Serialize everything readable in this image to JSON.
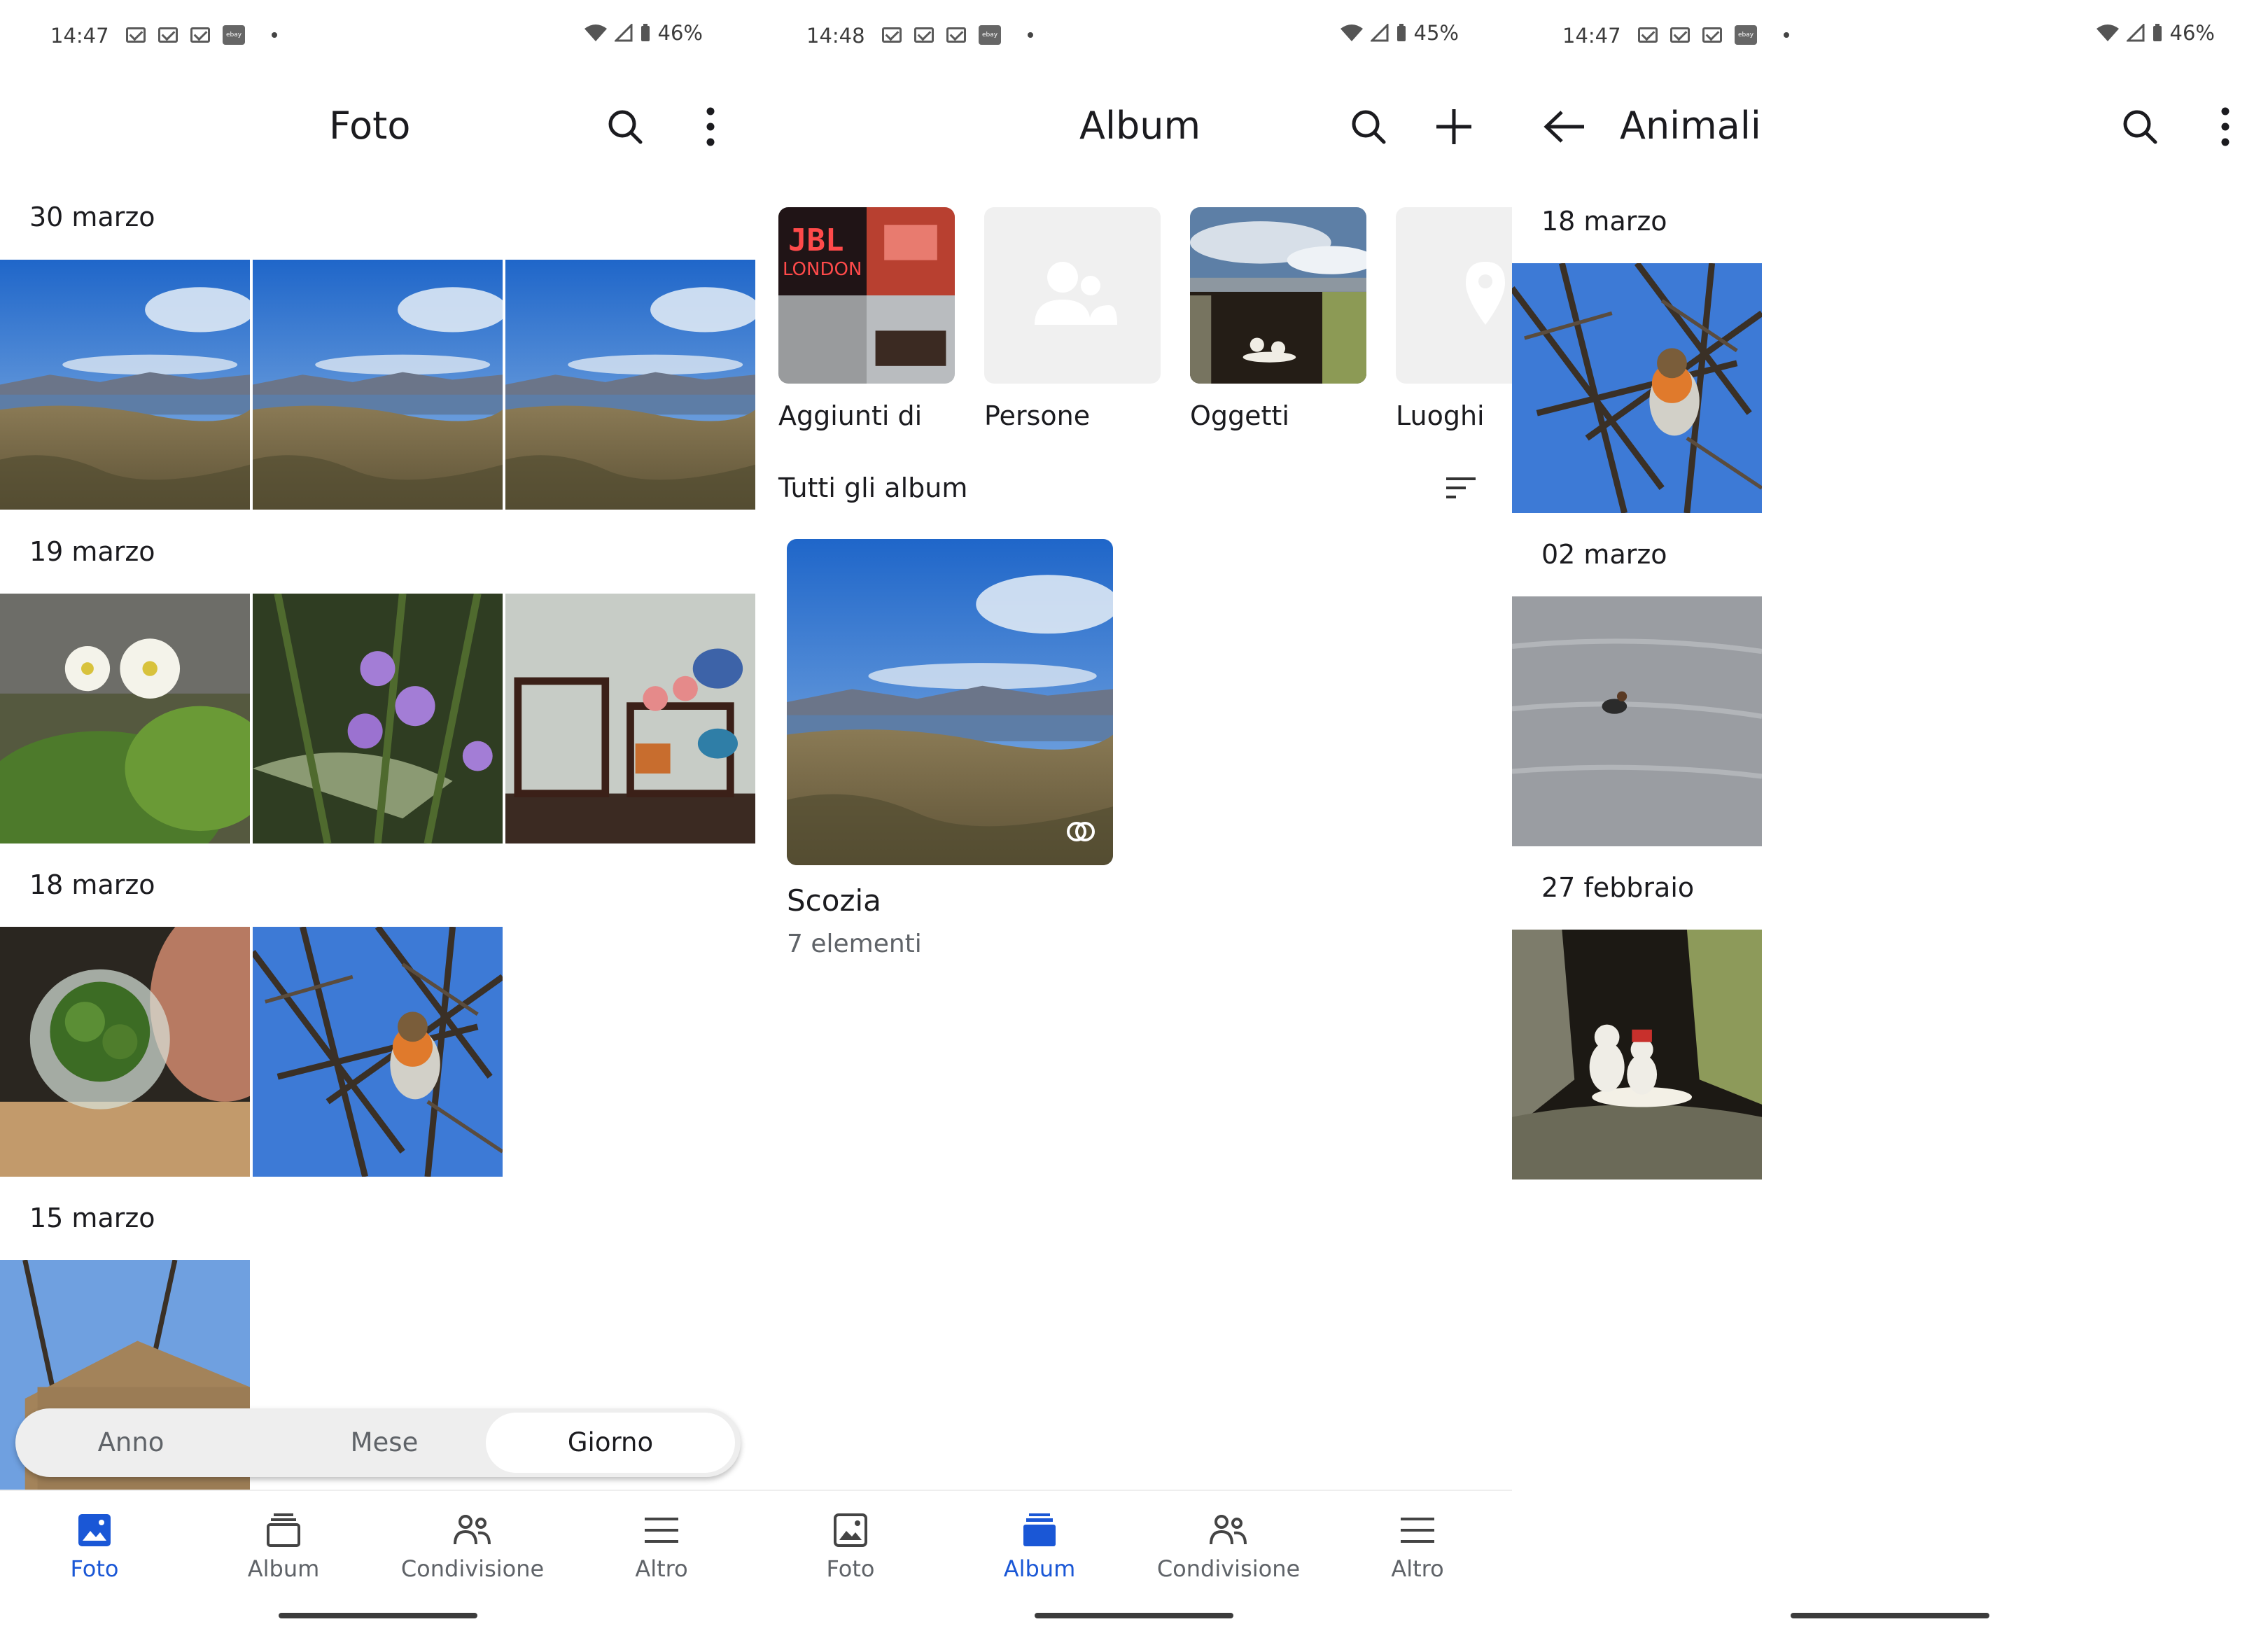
{
  "status_bars": [
    {
      "time": "14:47",
      "battery": "46%"
    },
    {
      "time": "14:48",
      "battery": "45%"
    },
    {
      "time": "14:47",
      "battery": "46%"
    }
  ],
  "foto_screen": {
    "title": "Foto",
    "sections": [
      "30 marzo",
      "19 marzo",
      "18 marzo",
      "15 marzo"
    ],
    "segmented": {
      "options": [
        "Anno",
        "Mese",
        "Giorno"
      ],
      "selected": "Giorno"
    }
  },
  "album_screen": {
    "title": "Album",
    "top_albums": [
      "Aggiunti di",
      "Persone",
      "Oggetti",
      "Luoghi"
    ],
    "all_albums_header": "Tutti gli album",
    "album": {
      "name": "Scozia",
      "count": "7 elementi"
    },
    "jbl_text": [
      "JBL",
      "LONDON"
    ]
  },
  "animali_screen": {
    "title": "Animali",
    "sections": [
      "18 marzo",
      "02 marzo",
      "27 febbraio"
    ]
  },
  "bottom_nav": [
    "Foto",
    "Album",
    "Condivisione",
    "Altro"
  ],
  "colors": {
    "accent": "#1a57d6",
    "text": "#1b1b1f",
    "muted": "#5f6368",
    "pill_bg": "#eeeeee"
  }
}
